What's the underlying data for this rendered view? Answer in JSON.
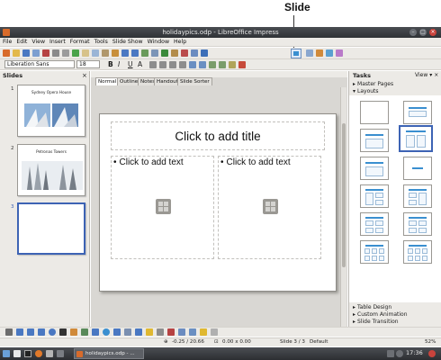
{
  "callout": {
    "label": "Slide"
  },
  "window": {
    "title": "holidaypics.odp - LibreOffice Impress"
  },
  "menus": [
    "File",
    "Edit",
    "View",
    "Insert",
    "Format",
    "Tools",
    "Slide Show",
    "Window",
    "Help"
  ],
  "format_toolbar": {
    "font_name": "Liberation Sans",
    "font_size": "18",
    "bold": "B",
    "italic": "I",
    "underline": "U",
    "char_a": "A"
  },
  "slides_panel": {
    "title": "Slides",
    "slides": [
      {
        "number": "1",
        "caption": "Sydney Opera House"
      },
      {
        "number": "2",
        "caption": "Petronas Towers"
      },
      {
        "number": "3",
        "caption": ""
      }
    ]
  },
  "view_tabs": [
    "Normal",
    "Outline",
    "Notes",
    "Handout",
    "Slide Sorter"
  ],
  "slide": {
    "title_placeholder": "Click to add title",
    "left_text_placeholder": "Click to add text",
    "right_text_placeholder": "Click to add text",
    "bullet": "•"
  },
  "tasks_panel": {
    "title": "Tasks",
    "view_menu": "View",
    "sections": {
      "master_pages": "Master Pages",
      "layouts": "Layouts",
      "table_design": "Table Design",
      "custom_animation": "Custom Animation",
      "slide_transition": "Slide Transition"
    }
  },
  "status": {
    "position": "-0.25 / 20.66",
    "size": "0.00 x 0.00",
    "slide": "Slide 3 / 3",
    "master": "Default",
    "zoom": "52%"
  },
  "taskbar": {
    "task": "holidaypics.odp - ...",
    "clock": "17:36"
  },
  "colors": {
    "accent": "#3a8fd0",
    "selection": "#3d63b4",
    "titlebar": "#3b3e43"
  },
  "icons": [
    "close-icon",
    "minimize-icon",
    "maximize-icon",
    "new-icon",
    "open-icon",
    "save-icon",
    "slide-icon",
    "picture-icon",
    "chart-icon"
  ]
}
